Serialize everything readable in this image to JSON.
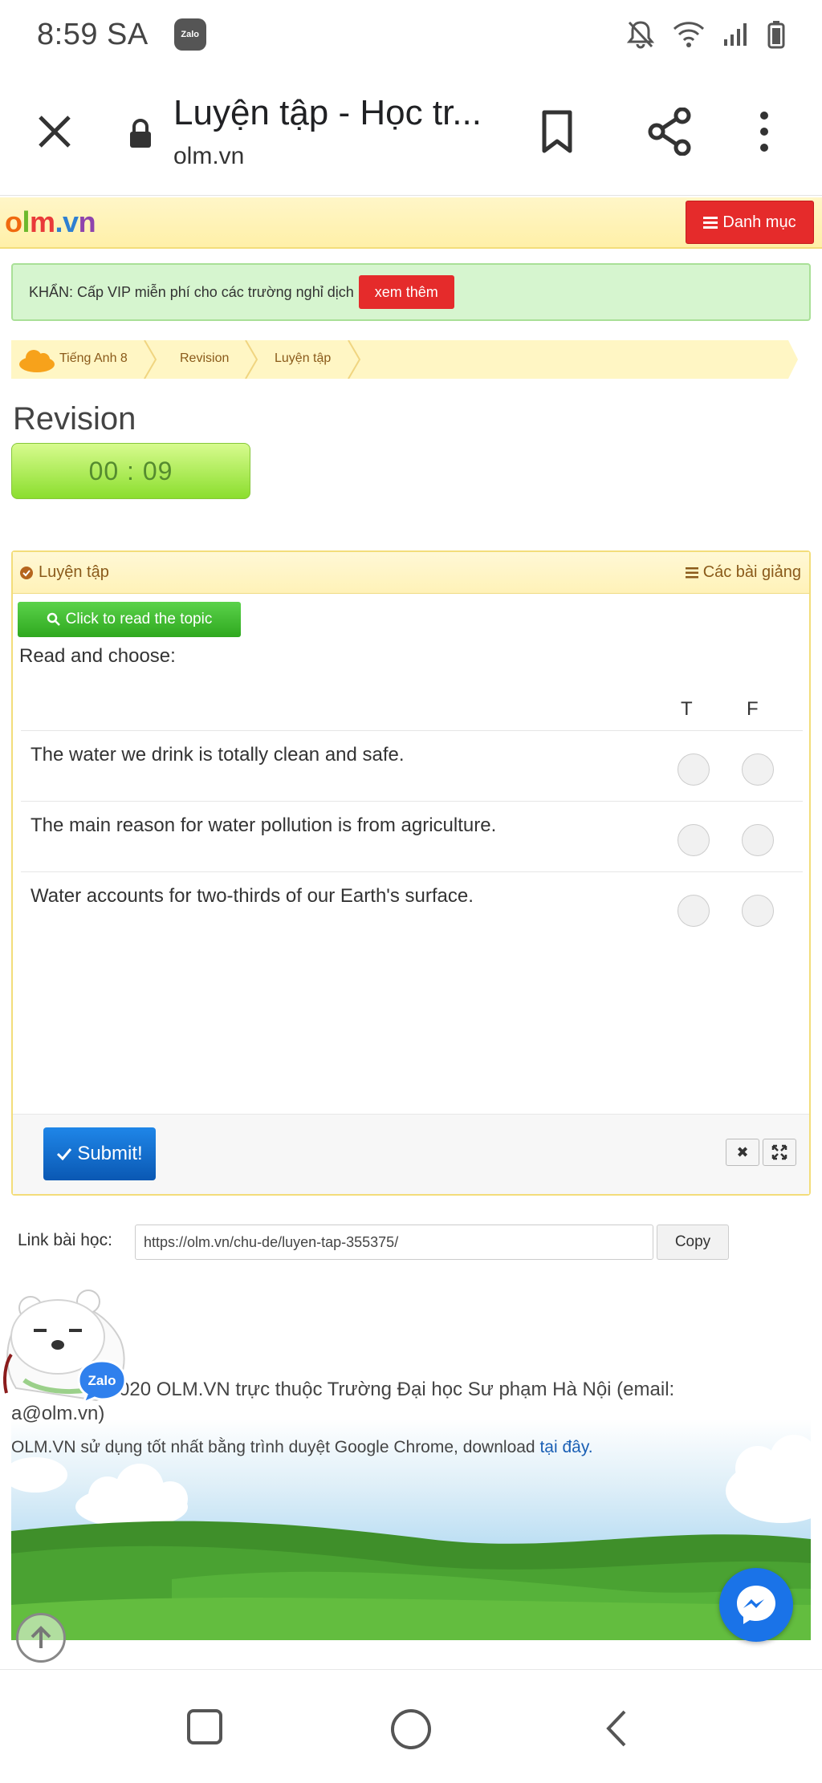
{
  "status_bar": {
    "time": "8:59 SA",
    "notification_app": "Zalo",
    "icons": [
      "bell-off-icon",
      "wifi-icon",
      "signal-icon",
      "battery-icon"
    ]
  },
  "browser": {
    "page_title": "Luyện tập - Học tr...",
    "url": "olm.vn"
  },
  "site": {
    "logo_parts": [
      "o",
      "l",
      "m",
      ".v",
      "n"
    ],
    "menu_label": "Danh mục"
  },
  "alert": {
    "text": "KHẨN: Cấp VIP miễn phí cho các trường nghỉ dịch",
    "button_label": "xem thêm"
  },
  "breadcrumb": [
    "Tiếng Anh 8",
    "Revision",
    "Luyện tập"
  ],
  "title": "Revision",
  "timer": "00 : 09",
  "panel": {
    "left_label": "Luyện tập",
    "right_label": "Các bài giảng",
    "topic_button": "Click to read the topic",
    "instructions": "Read and choose:",
    "col_true": "T",
    "col_false": "F",
    "questions": [
      "The water we drink is totally clean and safe.",
      "The main reason for water pollution is from agriculture.",
      "Water accounts for two-thirds of our Earth's surface."
    ],
    "submit_label": "Submit!"
  },
  "link_row": {
    "label": "Link bài học:",
    "value": "https://olm.vn/chu-de/luyen-tap-355375/",
    "copy_label": "Copy"
  },
  "footer": {
    "line1": "020 OLM.VN trực thuộc Trường Đại học Sư phạm Hà Nội (email:",
    "line1b": "a@olm.vn)",
    "line2_text": "OLM.VN sử dụng tốt nhất bằng trình duyệt Google Chrome, download ",
    "line2_link": "tại đây."
  },
  "zalo_bubble": "Zalo",
  "colors": {
    "accent_red": "#e52b2b",
    "timer_green": "#8bde2e",
    "submit_blue": "#0a58b3",
    "header_yellow": "#fff0a8"
  }
}
